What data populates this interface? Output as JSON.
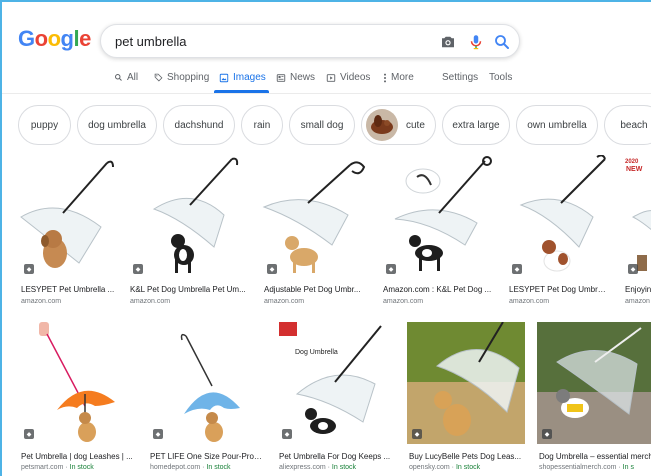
{
  "logo": {
    "letters": [
      "G",
      "o",
      "o",
      "g",
      "l",
      "e"
    ],
    "colors": [
      "#4285f4",
      "#ea4335",
      "#fbbc05",
      "#4285f4",
      "#34a853",
      "#ea4335"
    ]
  },
  "search": {
    "query": "pet umbrella"
  },
  "tabs": [
    {
      "label": "All",
      "icon": "search-icon"
    },
    {
      "label": "Shopping",
      "icon": "tag-icon"
    },
    {
      "label": "Images",
      "icon": "image-icon",
      "active": true
    },
    {
      "label": "News",
      "icon": "news-icon"
    },
    {
      "label": "Videos",
      "icon": "video-icon"
    },
    {
      "label": "More",
      "icon": "kebab-icon"
    },
    {
      "label": "Settings"
    },
    {
      "label": "Tools"
    }
  ],
  "chips": [
    "puppy",
    "dog umbrella",
    "dachshund",
    "rain",
    "small dog",
    "cute",
    "extra large",
    "own umbrella",
    "beach"
  ],
  "row1": [
    {
      "title": "LESYPET Pet Umbrella ...",
      "source": "amazon.com"
    },
    {
      "title": "K&L Pet Dog Umbrella Pet Um...",
      "source": "amazon.com"
    },
    {
      "title": "Adjustable Pet Dog Umbr...",
      "source": "amazon.com"
    },
    {
      "title": "Amazon.com : K&L Pet Dog ...",
      "source": "amazon.com"
    },
    {
      "title": "LESYPET Pet Dog Umbrel...",
      "source": "amazon.com"
    },
    {
      "title": "Enjoyin",
      "source": "amazon"
    }
  ],
  "row2": [
    {
      "title": "Pet Umbrella | dog Leashes | ...",
      "source": "petsmart.com",
      "stock": "In stock"
    },
    {
      "title": "PET LIFE One Size Pour-Prot...",
      "source": "homedepot.com",
      "stock": "In stock"
    },
    {
      "title": "Pet Umbrella For Dog Keeps ...",
      "source": "aliexpress.com",
      "stock": "In stock"
    },
    {
      "title": "Buy LucyBelle Pets Dog Leas...",
      "source": "opensky.com",
      "stock": "In stock"
    },
    {
      "title": "Dog Umbrella – essential merch",
      "source": "shopessentialmerch.com",
      "stock": "In s"
    }
  ],
  "overlays": {
    "dog_umbrella_label": "Dog Umbrella",
    "year_label": "2020",
    "new_label": "NEW"
  },
  "separator": " · "
}
